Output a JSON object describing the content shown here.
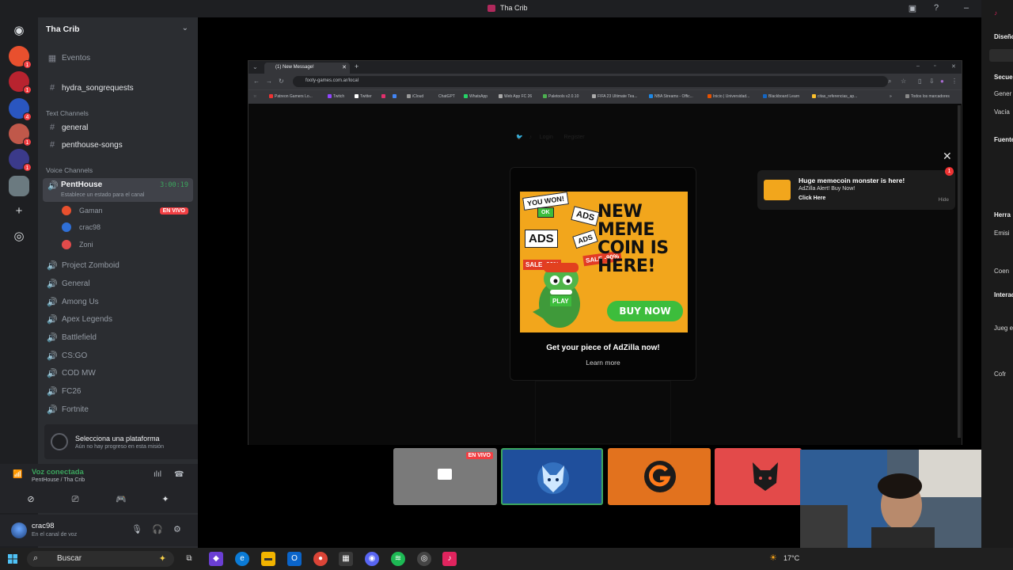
{
  "window": {
    "title": "Tha Crib"
  },
  "sidebar": {
    "guild_name": "Tha Crib",
    "events_label": "Eventos",
    "pinned_channel": "hydra_songrequests",
    "text_category": "Text Channels",
    "text_channels": [
      "general",
      "penthouse-songs"
    ],
    "voice_category": "Voice Channels",
    "active_voice": {
      "name": "PentHouse",
      "status_hint": "Establece un estado para el canal",
      "timer": "3:00:19",
      "users": [
        {
          "name": "Gaman",
          "badge": "EN VIVO",
          "color": "#e8502e"
        },
        {
          "name": "crac98",
          "badge": "",
          "color": "#2f6fd6"
        },
        {
          "name": "Zoni",
          "badge": "",
          "color": "#e24b4b"
        }
      ]
    },
    "voice_channels": [
      "Project Zomboid",
      "General",
      "Among Us",
      "Apex Legends",
      "Battlefield",
      "CS:GO",
      "COD MW",
      "FC26",
      "Fortnite"
    ]
  },
  "platform_panel": {
    "title": "Selecciona una plataforma",
    "subtitle": "Aún no hay progreso en esta misión"
  },
  "voice_connection": {
    "status": "Voz conectada",
    "location": "PentHouse / Tha Crib"
  },
  "user": {
    "name": "crac98",
    "status": "En el canal de voz"
  },
  "browser": {
    "tab_title": "(1) New Message!",
    "url": "footy-games.com.ar/local",
    "bookmarks": [
      "Patreon Gamers Lo...",
      "Twitch",
      "Twitter",
      "iCloud",
      "ChatGPT",
      "WhatsApp",
      "Web App FC 26",
      "Paletools v2.0.10",
      "FIFA 23 Ultimate Tea...",
      "NBA Streams - Offic...",
      "Inicio | Universidad...",
      "Blackboard Learn",
      "citas_referencias_ap..."
    ],
    "bookmarks_all": "Todos los marcadores",
    "site_nav": [
      "Login",
      "Register"
    ]
  },
  "ad": {
    "headline": "NEW MEME COIN IS HERE!",
    "buy": "BUY NOW",
    "stickers": [
      "YOU WON!",
      "ADS",
      "ADS",
      "ADS"
    ],
    "ok": "OK",
    "sale": "SALE -90%",
    "play": "PLAY",
    "cta": "Get your piece of AdZilla now!",
    "learn_more": "Learn more"
  },
  "notification": {
    "title": "Huge memecoin monster is here!",
    "subtitle": "AdZilla Alert! Buy Now!",
    "action": "Click Here",
    "hide": "Hide",
    "count": "1"
  },
  "tiles": {
    "live_label": "EN VIVO"
  },
  "right_panel": [
    "Diseño",
    "Secue",
    "Gener",
    "Vacía",
    "Fuente",
    "Herra",
    "Emisi",
    "Coen",
    "Interac",
    "Jueg equ",
    "Cofr"
  ],
  "taskbar": {
    "search_label": "Buscar",
    "temperature": "17°C"
  },
  "colors": {
    "discord_bg": "#2b2d31",
    "accent_green": "#3ba55d",
    "live_red": "#f23f43",
    "ad_orange": "#f2a61c"
  }
}
